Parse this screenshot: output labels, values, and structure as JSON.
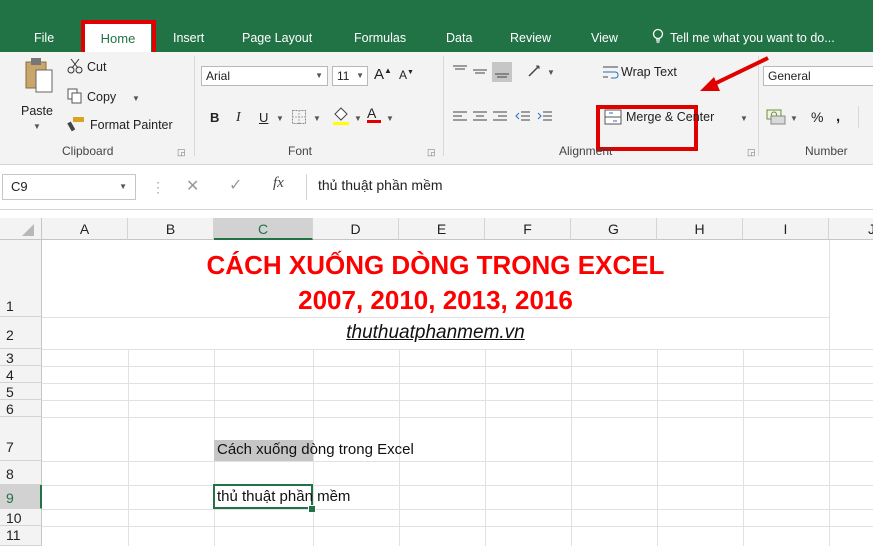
{
  "tabs": {
    "file": "File",
    "home": "Home",
    "insert": "Insert",
    "page_layout": "Page Layout",
    "formulas": "Formulas",
    "data": "Data",
    "review": "Review",
    "view": "View",
    "tell_me": "Tell me what you want to do..."
  },
  "ribbon": {
    "clipboard": {
      "paste": "Paste",
      "cut": "Cut",
      "copy": "Copy",
      "format_painter": "Format Painter",
      "label": "Clipboard"
    },
    "font": {
      "font_name": "Arial",
      "font_size": "11",
      "bold": "B",
      "italic": "I",
      "underline": "U",
      "grow": "A",
      "shrink": "A",
      "label": "Font"
    },
    "alignment": {
      "wrap_text": "Wrap Text",
      "merge_center": "Merge & Center",
      "label": "Alignment"
    },
    "number": {
      "format": "General",
      "percent": "%",
      "comma": ",",
      "label": "Number"
    }
  },
  "formula_bar": {
    "name_box": "C9",
    "fx": "fx",
    "content": "thủ thuật phần mềm"
  },
  "columns": [
    "A",
    "B",
    "C",
    "D",
    "E",
    "F",
    "G",
    "H",
    "I",
    "J"
  ],
  "rows": [
    "1",
    "2",
    "3",
    "4",
    "5",
    "6",
    "7",
    "8",
    "9",
    "10",
    "11"
  ],
  "cells": {
    "title_line1": "CÁCH XUỐNG DÒNG TRONG EXCEL",
    "title_line2": "2007, 2010, 2013, 2016",
    "website": "thuthuatphanmem.vn",
    "c7": "Cách xuống dòng trong Excel",
    "c9": "thủ thuật phần mềm"
  },
  "colors": {
    "excel_green": "#217346",
    "annotation_red": "#e00000",
    "title_red": "#ff0000"
  }
}
